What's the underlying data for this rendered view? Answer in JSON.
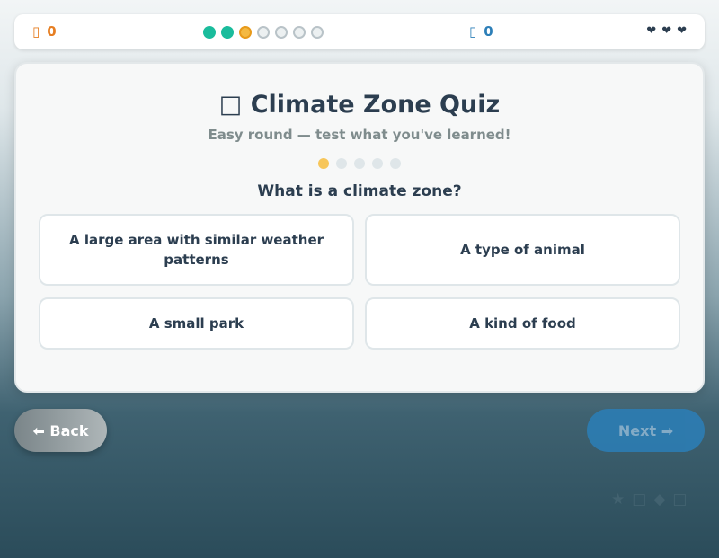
{
  "hud": {
    "coins_icon": "coin-icon",
    "coins": "0",
    "stars_icon": "star-icon",
    "stars": "0",
    "progress": [
      "done",
      "done",
      "current",
      "todo",
      "todo",
      "todo",
      "todo"
    ],
    "hearts": [
      "❤",
      "❤",
      "❤"
    ]
  },
  "quiz": {
    "title_icon": "□",
    "title": "Climate Zone Quiz",
    "subtitle": "Easy round — test what you've learned!",
    "question_index": 1,
    "question_total": 5,
    "question": "What is a climate zone?",
    "options": [
      "A large area with similar weather patterns",
      "A type of animal",
      "A small park",
      "A kind of food"
    ]
  },
  "nav": {
    "back": "⬅ Back",
    "next": "Next ➡"
  },
  "tray_icons": [
    "★",
    "□",
    "◆",
    "□"
  ],
  "colors": {
    "accent_orange": "#e67e22",
    "accent_blue": "#2d7fb8",
    "done_teal": "#1abc9c",
    "current_yellow": "#f4b942"
  }
}
